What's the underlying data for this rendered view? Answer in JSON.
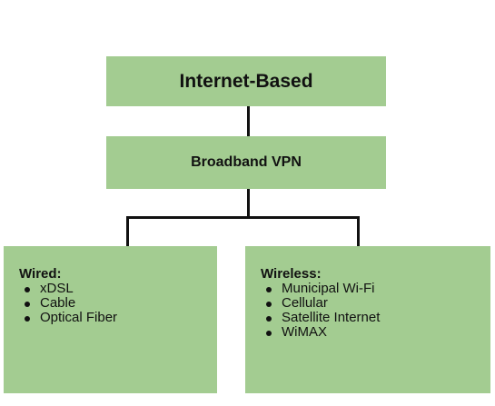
{
  "diagram": {
    "top": {
      "title": "Internet-Based"
    },
    "middle": {
      "title": "Broadband VPN"
    },
    "wired": {
      "title": "Wired:",
      "items": [
        "xDSL",
        "Cable",
        "Optical Fiber"
      ]
    },
    "wireless": {
      "title": "Wireless:",
      "items": [
        "Municipal Wi-Fi",
        "Cellular",
        "Satellite Internet",
        "WiMAX"
      ]
    },
    "colors": {
      "box_fill": "#a3cc91",
      "connector": "#111111",
      "text": "#111111"
    }
  }
}
